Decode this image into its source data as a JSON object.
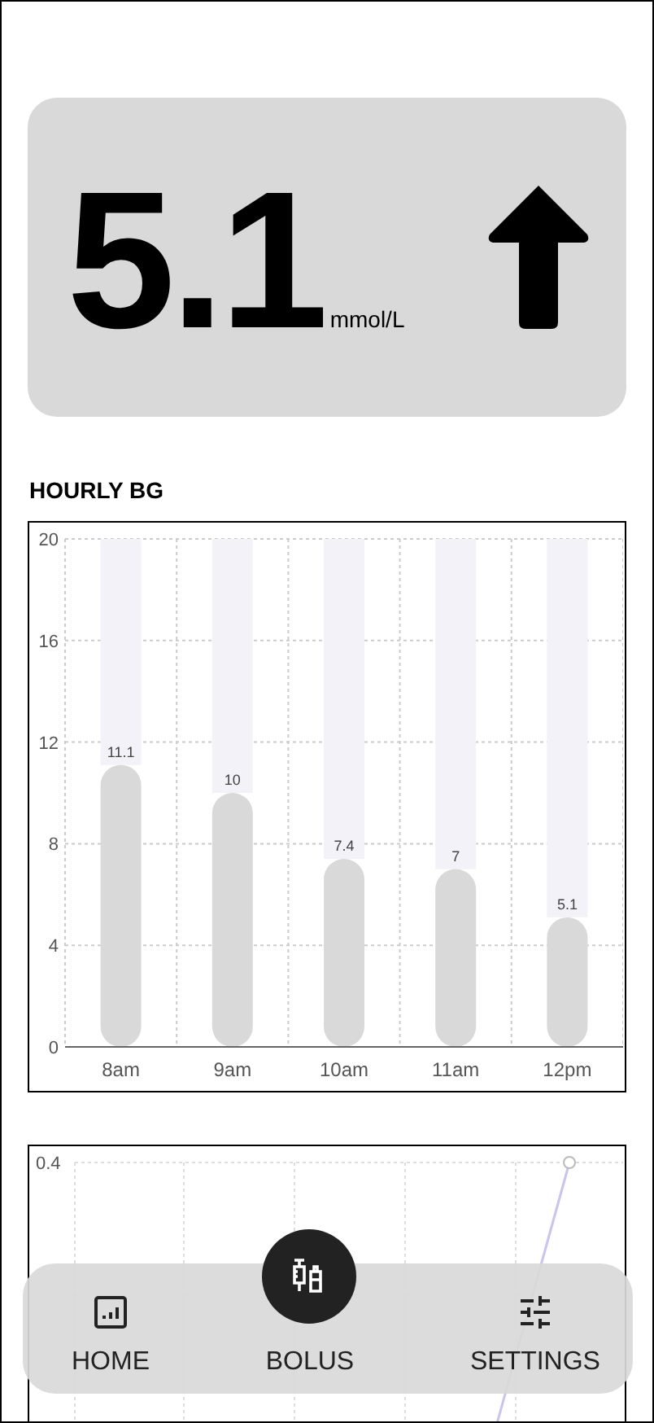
{
  "reading": {
    "value": "5.1",
    "unit": "mmol/L"
  },
  "hourly": {
    "title": "HOURLY BG",
    "chart_data": {
      "type": "bar",
      "categories": [
        "8am",
        "9am",
        "10am",
        "11am",
        "12pm"
      ],
      "series": [
        {
          "color": "#d9d9d9",
          "values": [
            11.1,
            10,
            7.4,
            7,
            5.1
          ]
        },
        {
          "color": "#f2f2f8",
          "values": [
            8.9,
            10,
            12.6,
            13,
            14.9
          ]
        }
      ],
      "stacked": true,
      "ylim": [
        0,
        20
      ],
      "yticks": [
        0,
        4,
        8,
        12,
        16,
        20
      ],
      "value_labels": [
        [
          "11.1",
          "10",
          "7.4",
          "7",
          "5.1"
        ],
        [
          null,
          null,
          null,
          null,
          null
        ]
      ],
      "grid": true
    }
  },
  "second_chart": {
    "y_labels": [
      "0.4"
    ]
  },
  "nav": [
    {
      "label": "HOME",
      "kind": "tab"
    },
    {
      "label": "BOLUS",
      "kind": "raised"
    },
    {
      "label": "SETTINGS",
      "kind": "tab"
    }
  ]
}
